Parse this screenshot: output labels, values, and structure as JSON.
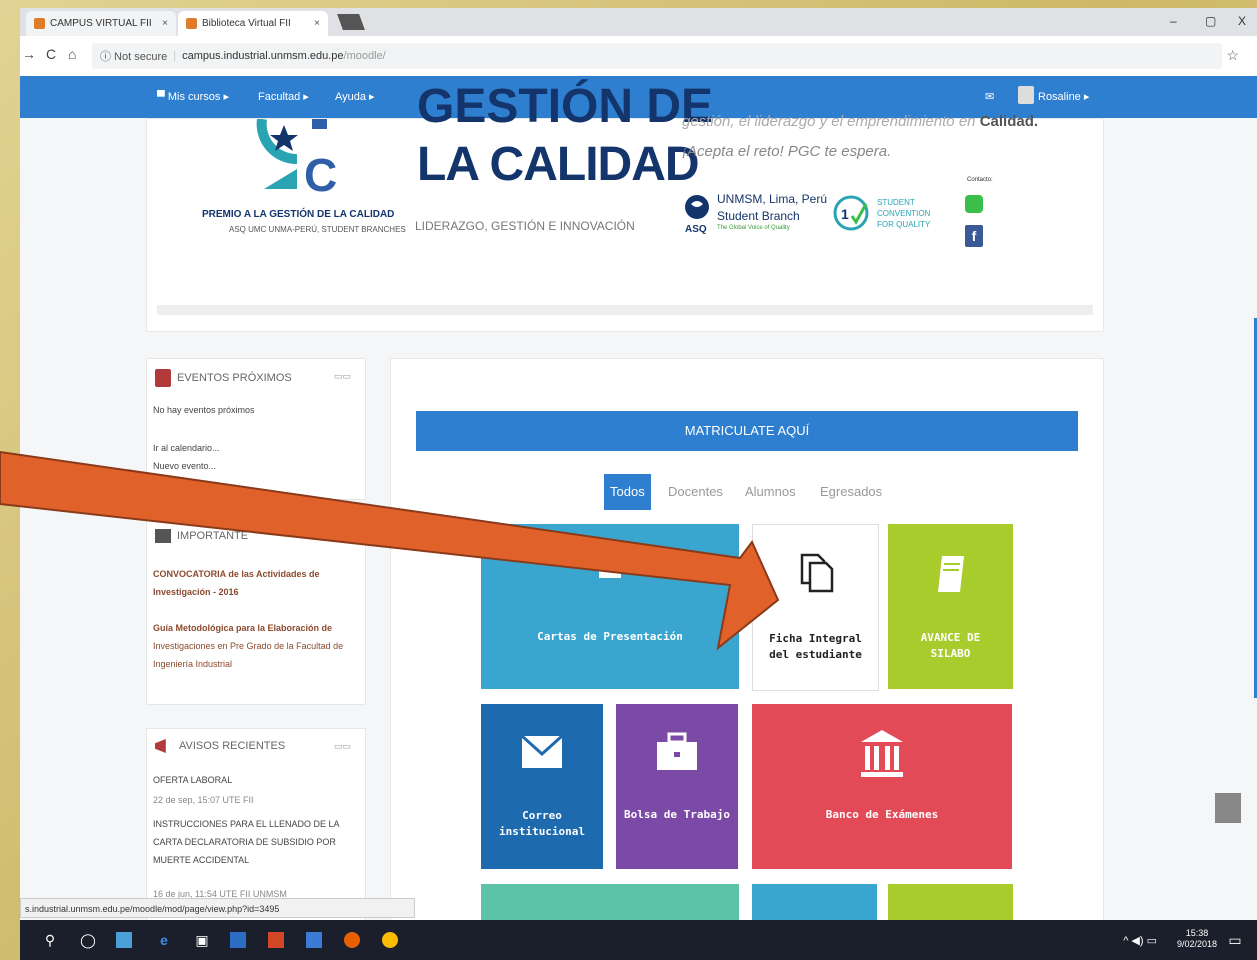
{
  "browser": {
    "tabs": [
      {
        "label": "CAMPUS VIRTUAL FII",
        "close": "×",
        "icon_color": "#e07b2a"
      },
      {
        "label": "Biblioteca Virtual FII",
        "close": "×",
        "icon_color": "#e07b2a"
      }
    ],
    "window_controls": {
      "minimize": "–",
      "maximize": "▢",
      "close": "X"
    },
    "address": {
      "security": "ⓘ Not secure",
      "host": "campus.industrial.unmsm.edu.pe",
      "path": "/moodle/"
    }
  },
  "moodle_nav": {
    "mis_cursos": "▀ Mis cursos ▸",
    "facultad": "Facultad ▸",
    "ayuda": "Ayuda ▸",
    "messages_icon": "✉",
    "user": "Rosaline ▸"
  },
  "banner": {
    "title_top": "GESTIÓN DE",
    "title": "LA CALIDAD",
    "premio": "PREMIO A LA GESTIÓN DE LA CALIDAD",
    "asq_line": "ASQ UMC UNMA-PERÚ, STUDENT BRANCHES",
    "liderazgo": "LIDERAZGO, GESTIÓN E INNOVACIÓN",
    "text_top": "gestión, el liderazgo y el emprendimiento en",
    "text_top_bold": "Calidad.",
    "acepta": "¡Acepta el reto! PGC te espera.",
    "asq_label": "ASQ",
    "unmsm": "UNMSM, Lima, Perú",
    "student_branch": "Student Branch",
    "global_voice": "The Global Voice of Quality",
    "convention": [
      "STUDENT",
      "CONVENTION",
      "FOR QUALITY"
    ],
    "contacto": "Contacto:"
  },
  "eventos": {
    "title": "EVENTOS PRÓXIMOS",
    "none": "No hay eventos próximos",
    "ir": "Ir al calendario...",
    "nuevo": "Nuevo evento..."
  },
  "info_block": {
    "title": "IMPORTANTE",
    "links": [
      {
        "bold": "CONVOCATORIA de las Actividades de Investigación - 2016",
        "rest": ""
      },
      {
        "bold": "Guía Metodológica para la Elaboración de",
        "rest": " Investigaciones en Pre Grado de la Facultad de Ingeniería Industrial"
      }
    ]
  },
  "avisos": {
    "title": "AVISOS RECIENTES",
    "items": [
      {
        "title": "OFERTA LABORAL",
        "date": "22 de sep, 15:07 UTE FII"
      },
      {
        "title": "INSTRUCCIONES PARA EL LLENADO DE LA CARTA DECLARATORIA DE SUBSIDIO POR MUERTE ACCIDENTAL",
        "date": "16 de jun, 11:54 UTE FII UNMSM"
      }
    ]
  },
  "main": {
    "matriculate": "MATRICULATE AQUÍ",
    "filters": [
      "Todos",
      "Docentes",
      "Alumnos",
      "Egresados"
    ],
    "tiles": [
      {
        "label": "Cartas de Presentación",
        "color": "#3aa6d0",
        "icon": "document-icon"
      },
      {
        "label": "Ficha Integral del estudiante",
        "color": "#ffffff",
        "icon": "copy-icon"
      },
      {
        "label": "AVANCE DE SILABO",
        "color": "#a8cc2c",
        "icon": "book-icon"
      },
      {
        "label": "Correo institucional",
        "color": "#1e6aae",
        "icon": "envelope-icon"
      },
      {
        "label": "Bolsa de Trabajo",
        "color": "#7b4aa6",
        "icon": "briefcase-icon"
      },
      {
        "label": "Banco de Exámenes",
        "color": "#e14a56",
        "icon": "bank-icon"
      }
    ]
  },
  "status_url": "s.industrial.unmsm.edu.pe/moodle/mod/page/view.php?id=3495",
  "taskbar": {
    "time": "15:38",
    "date": "9/02/2018",
    "tray": "^ ◀) ▭"
  },
  "colors": {
    "moodle_blue": "#2f7fd0",
    "arrow": "#e0622a",
    "frame": "#d8c77a"
  }
}
